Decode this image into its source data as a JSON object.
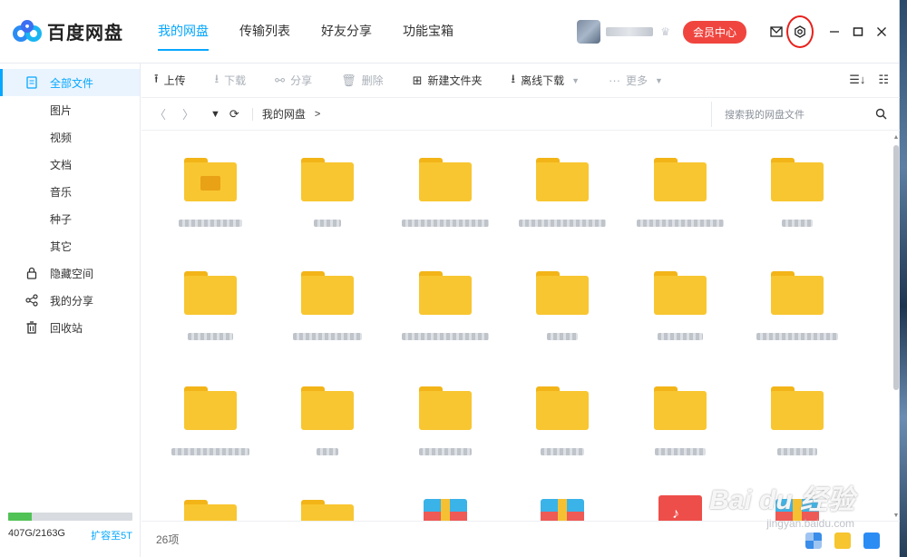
{
  "app": {
    "name": "百度网盘"
  },
  "nav": {
    "tabs": [
      "我的网盘",
      "传输列表",
      "好友分享",
      "功能宝箱"
    ]
  },
  "header": {
    "vip_label": "会员中心"
  },
  "sidebar": {
    "items": [
      {
        "label": "全部文件"
      },
      {
        "label": "图片"
      },
      {
        "label": "视频"
      },
      {
        "label": "文档"
      },
      {
        "label": "音乐"
      },
      {
        "label": "种子"
      },
      {
        "label": "其它"
      },
      {
        "label": "隐藏空间"
      },
      {
        "label": "我的分享"
      },
      {
        "label": "回收站"
      }
    ],
    "quota_text": "407G/2163G",
    "quota_fraction": 0.188,
    "expand_label": "扩容至5T"
  },
  "toolbar": {
    "upload": "上传",
    "download": "下载",
    "share": "分享",
    "delete": "删除",
    "new_folder": "新建文件夹",
    "offline_download": "离线下载",
    "more": "更多"
  },
  "pathbar": {
    "crumb": "我的网盘",
    "arrow": ">",
    "search_placeholder": "搜索我的网盘文件"
  },
  "status": {
    "count": "26项"
  },
  "watermark": {
    "brand": "Bai du 经验",
    "url": "jingyan.baidu.com"
  },
  "colors": {
    "accent": "#06a7ff",
    "vip": "#f0453f",
    "folder": "#f8c631",
    "highlight_ring": "#e8201a"
  }
}
